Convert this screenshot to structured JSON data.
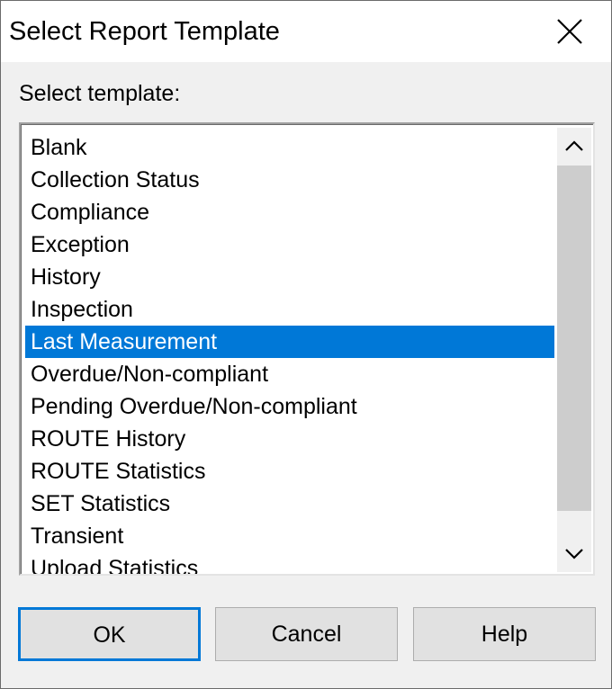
{
  "dialog": {
    "title": "Select Report Template",
    "close_icon": "close-icon"
  },
  "prompt": "Select template:",
  "templates": [
    "Blank",
    "Collection Status",
    "Compliance",
    "Exception",
    "History",
    "Inspection",
    "Last Measurement",
    "Overdue/Non-compliant",
    "Pending Overdue/Non-compliant",
    "ROUTE History",
    "ROUTE Statistics",
    "SET Statistics",
    "Transient",
    "Upload Statistics"
  ],
  "selected_template": "Last Measurement",
  "scrollbar": {
    "up_icon": "chevron-up-icon",
    "down_icon": "chevron-down-icon"
  },
  "buttons": {
    "ok": "OK",
    "cancel": "Cancel",
    "help": "Help"
  },
  "colors": {
    "selection": "#0078d7",
    "default_button_border": "#0078d7"
  }
}
